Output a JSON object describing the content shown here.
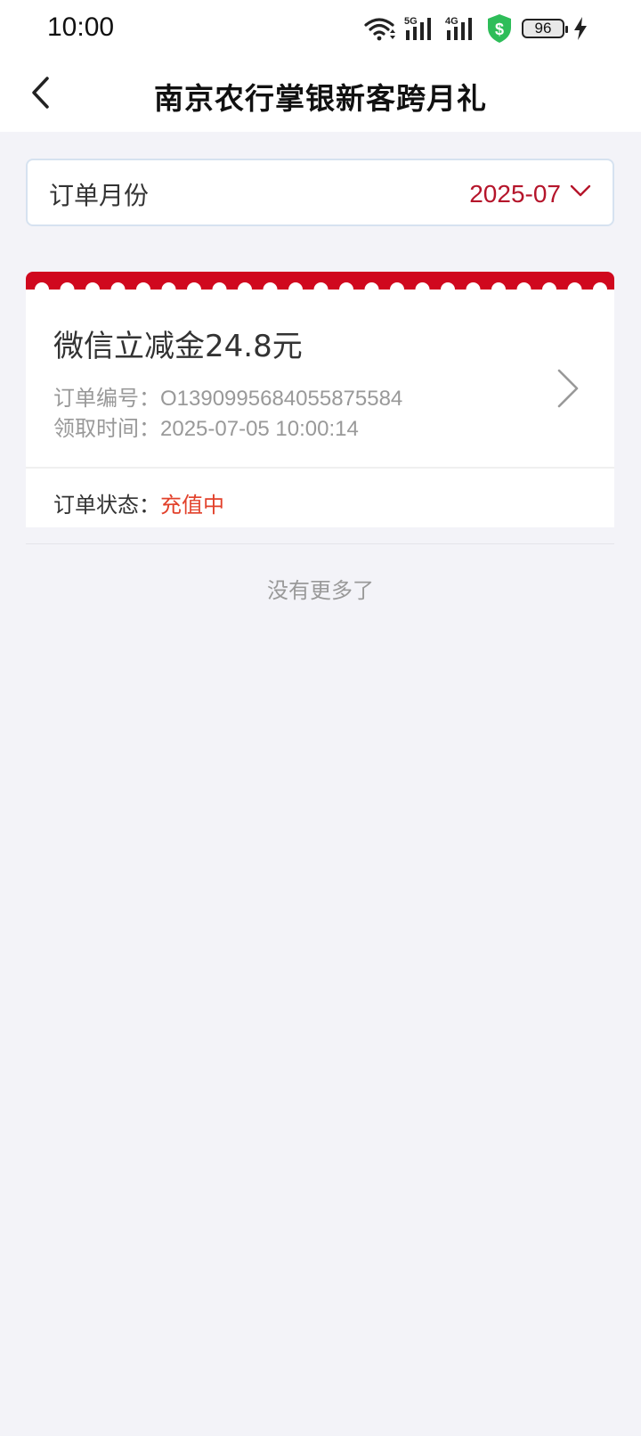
{
  "status_bar": {
    "time": "10:00",
    "network_1": "5G",
    "network_2": "4G",
    "battery": "96",
    "icons": [
      "wifi-icon",
      "signal-5g-icon",
      "signal-4g-icon",
      "shield-dollar-icon",
      "battery-icon",
      "charging-icon"
    ]
  },
  "header": {
    "back_icon": "chevron-left-icon",
    "title": "南京农行掌银新客跨月礼"
  },
  "month_filter": {
    "label": "订单月份",
    "value": "2025-07",
    "icon": "chevron-down-icon"
  },
  "orders": [
    {
      "product": "微信立减金24.8元",
      "order_no_label": "订单编号：",
      "order_no": "O1390995684055875584",
      "claim_time_label": "领取时间：",
      "claim_time": "2025-07-05 10:00:14",
      "status_label": "订单状态：",
      "status": "充值中"
    }
  ],
  "footer": {
    "no_more": "没有更多了"
  },
  "colors": {
    "accent_red": "#b5152b",
    "ticket_red": "#d0081e",
    "status_orange_red": "#e2412b",
    "background": "#f3f3f8",
    "shield_green": "#2ebd59"
  }
}
